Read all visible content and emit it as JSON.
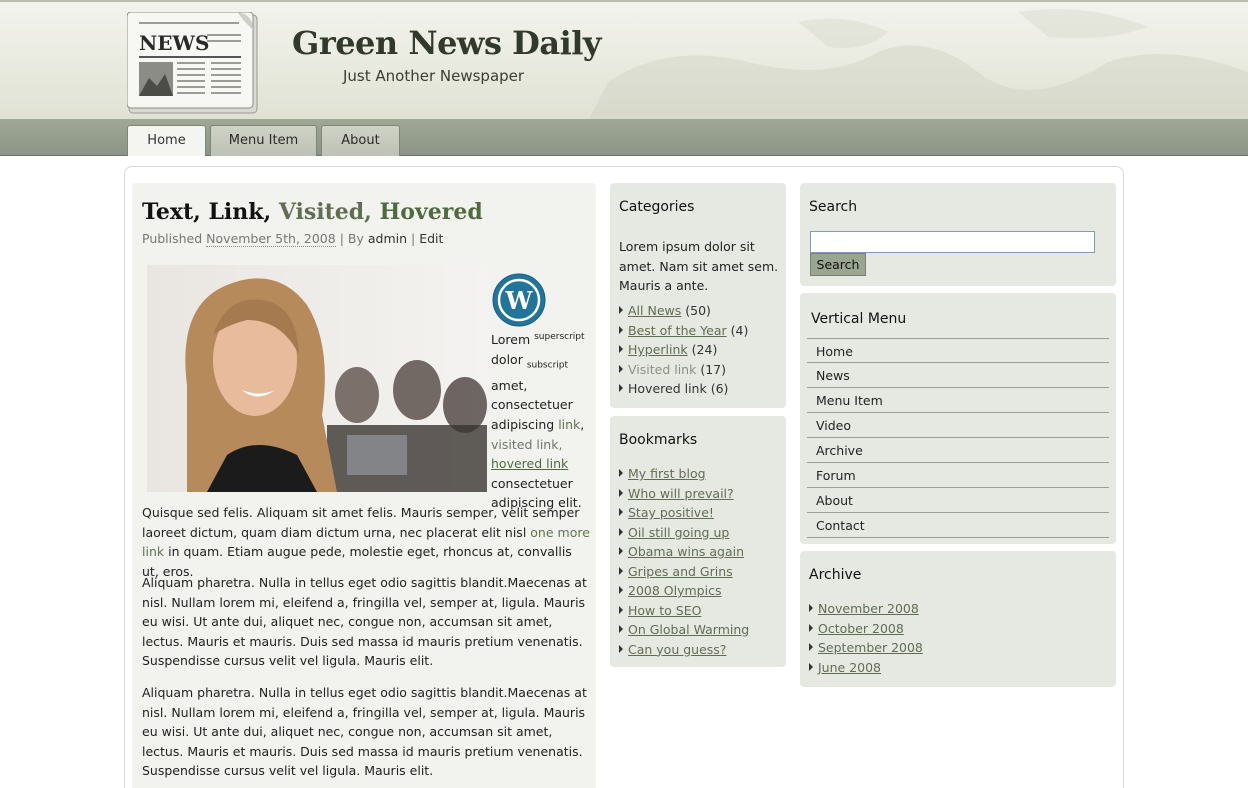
{
  "site": {
    "title": "Green News Daily",
    "subtitle": "Just Another Newspaper",
    "logo_text": "NEWS"
  },
  "nav": {
    "tabs": [
      {
        "label": "Home"
      },
      {
        "label": "Menu Item"
      },
      {
        "label": "About"
      }
    ],
    "active": "Home"
  },
  "post": {
    "title_parts": {
      "a": "Text, Link,",
      "b": "Visited,",
      "c": "Hovered"
    },
    "meta": {
      "prefix": "Published",
      "date": "November 5th, 2008",
      "sep1": "| By",
      "author": "admin",
      "sep2": "|",
      "edit": "Edit"
    },
    "side": {
      "lorem": "Lorem",
      "sup": "superscript",
      "dolor": "dolor",
      "sub": "subscript",
      "t1": "amet, consectetuer adipiscing",
      "link": "link",
      "visited": "visited link,",
      "hovered": "hovered link",
      "t2": "consectetuer adipiscing elit."
    },
    "para1_a": "Quisque sed felis. Aliquam sit amet felis. Mauris semper, velit semper laoreet dictum, quam diam dictum urna, nec placerat elit nisl",
    "para1_link": "one more link",
    "para1_b": "in quam. Etiam augue pede, molestie eget, rhoncus at, convallis ut, eros.",
    "para2": "Aliquam pharetra. Nulla in tellus eget odio sagittis blandit.Maecenas at nisl. Nullam lorem mi, eleifend a, fringilla vel, semper at, ligula. Mauris eu wisi. Ut ante dui, aliquet nec, congue non, accumsan sit amet, lectus. Mauris et mauris. Duis sed massa id mauris pretium venenatis. Suspendisse cursus velit vel ligula. Mauris elit.",
    "para3": "Aliquam pharetra. Nulla in tellus eget odio sagittis blandit.Maecenas at nisl. Nullam lorem mi, eleifend a, fringilla vel, semper at, ligula. Mauris eu wisi. Ut ante dui, aliquet nec, congue non, accumsan sit amet, lectus. Mauris et mauris. Duis sed massa id mauris pretium venenatis. Suspendisse cursus velit vel ligula. Mauris elit."
  },
  "categories": {
    "title": "Categories",
    "intro": "Lorem ipsum dolor sit amet. Nam sit amet sem. Mauris a ante.",
    "items": [
      {
        "label": "All News",
        "count": "(50)"
      },
      {
        "label": "Best of the Year",
        "count": "(4)"
      },
      {
        "label": "Hyperlink",
        "count": "(24)"
      },
      {
        "label": "Visited link",
        "count": "(17)"
      },
      {
        "label": "Hovered link",
        "count": "(6)"
      }
    ]
  },
  "bookmarks": {
    "title": "Bookmarks",
    "items": [
      "My first blog",
      "Who will prevail?",
      "Stay positive!",
      "Oil still going up",
      "Obama wins again",
      "Gripes and Grins",
      "2008 Olympics",
      "How to SEO",
      "On Global Warming",
      "Can you guess?"
    ]
  },
  "search": {
    "title": "Search",
    "button": "Search",
    "value": ""
  },
  "vertical_menu": {
    "title": "Vertical Menu",
    "items": [
      "Home",
      "News",
      "Menu Item",
      "Video",
      "Archive",
      "Forum",
      "About",
      "Contact"
    ]
  },
  "archive": {
    "title": "Archive",
    "items": [
      "November 2008",
      "October 2008",
      "September 2008",
      "June 2008"
    ]
  }
}
